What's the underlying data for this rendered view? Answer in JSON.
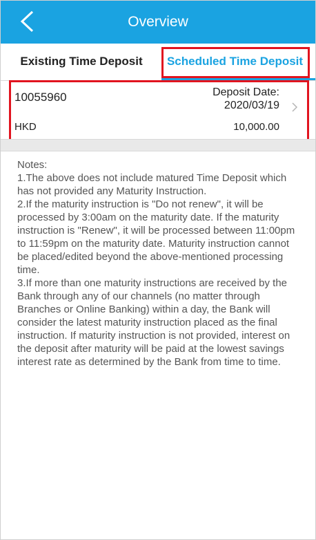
{
  "header": {
    "title": "Overview",
    "back_icon": "chevron-left-icon"
  },
  "tabs": [
    {
      "label": "Existing Time Deposit",
      "active": false
    },
    {
      "label": "Scheduled Time Deposit",
      "active": true
    }
  ],
  "deposit": {
    "account": "10055960",
    "date_label": "Deposit Date:",
    "date": "2020/03/19",
    "currency": "HKD",
    "amount": "10,000.00"
  },
  "notes": {
    "title": "Notes:",
    "text": "1.The above does not include matured Time Deposit which has not provided any Maturity Instruction.\n2.If the maturity instruction is \"Do not renew\", it will be processed by 3:00am on the maturity date. If the maturity instruction is \"Renew\", it will be processed between 11:00pm to 11:59pm on the maturity date. Maturity instruction cannot be placed/edited beyond the above-mentioned processing time.\n3.If more than one maturity instructions are received by the Bank through any of our channels (no matter through Branches or Online Banking) within a day, the Bank will consider the latest maturity instruction placed as the final instruction. If maturity instruction is not provided, interest on the deposit after maturity will be paid at the lowest savings interest rate as determined by the Bank from time to time."
  },
  "colors": {
    "accent": "#1aa3e1",
    "highlight": "#e1141f"
  }
}
